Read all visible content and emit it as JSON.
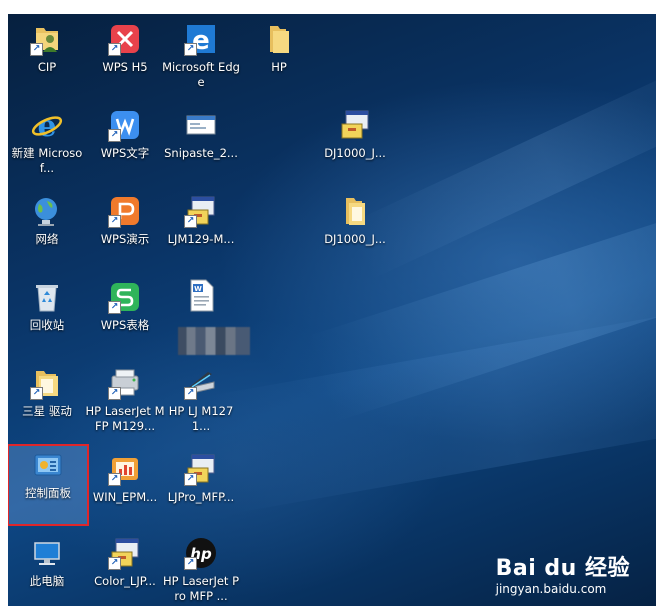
{
  "desktop": {
    "icons": {
      "cip": {
        "label": "CIP"
      },
      "wps_h5": {
        "label": "WPS H5"
      },
      "edge": {
        "label": "Microsoft Edge"
      },
      "hp": {
        "label": "HP"
      },
      "new_microsoft": {
        "label": "新建 Microsof..."
      },
      "wps_writer": {
        "label": "WPS文字"
      },
      "snipaste": {
        "label": "Snipaste_2..."
      },
      "dj1000_a": {
        "label": "DJ1000_J..."
      },
      "network": {
        "label": "网络"
      },
      "wps_present": {
        "label": "WPS演示"
      },
      "ljm129": {
        "label": "LJM129-M..."
      },
      "dj1000_b": {
        "label": "DJ1000_J..."
      },
      "recycle": {
        "label": "回收站"
      },
      "wps_sheet": {
        "label": "WPS表格"
      },
      "doc": {
        "label": ""
      },
      "samsung": {
        "label": "三星 驱动"
      },
      "hp_mfp129": {
        "label": "HP LaserJet MFP M129..."
      },
      "hp_m1271": {
        "label": "HP LJ M1271..."
      },
      "control_panel": {
        "label": "控制面板"
      },
      "win_epm": {
        "label": "WIN_EPM..."
      },
      "ljpro": {
        "label": "LJPro_MFP..."
      },
      "this_pc": {
        "label": "此电脑"
      },
      "color_lj": {
        "label": "Color_LJP..."
      },
      "hp_laserjet_pro": {
        "label": "HP LaserJet Pro MFP ..."
      }
    }
  },
  "watermark": {
    "brand": "Bai du 经验",
    "url": "jingyan.baidu.com"
  },
  "colors": {
    "selection_outline": "#e0262a",
    "desktop_bg": "#0a3466"
  }
}
